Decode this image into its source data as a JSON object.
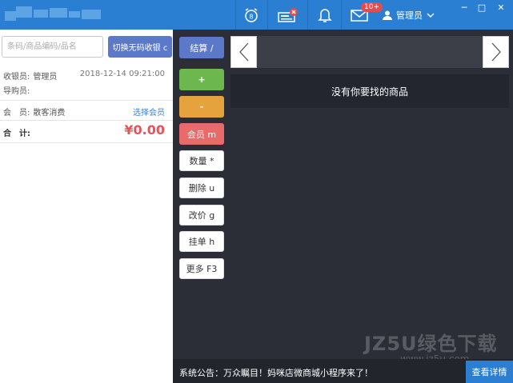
{
  "header": {
    "badge_count": "10+",
    "user_name": "管理员",
    "window_min": "─",
    "window_max": "□",
    "window_close": "✕",
    "icons": [
      "alarm-clock-icon",
      "card-reader-icon",
      "bell-icon",
      "mail-icon",
      "user-icon"
    ],
    "brand_color": "#2a7fd3"
  },
  "left": {
    "search_placeholder": "条码/商品编码/品名",
    "switch_button": "切换无码收银 c",
    "cashier_label": "收银员:",
    "cashier_name": "管理员",
    "datetime": "2018-12-14 09:21:00",
    "guide_label": "导购员:",
    "member_label": "会　员:",
    "member_value": "散客消费",
    "select_member": "选择会员",
    "total_label": "合　计:",
    "total_value": "¥0.00"
  },
  "middle": {
    "buttons": [
      {
        "label": "结算 /",
        "color": "#5b79c8"
      },
      {
        "label": "+",
        "color": "#6cb84f"
      },
      {
        "label": "-",
        "color": "#e6a23c"
      },
      {
        "label": "会员 m",
        "color": "#e86a6a"
      },
      {
        "label": "数量 *"
      },
      {
        "label": "删除 u"
      },
      {
        "label": "改价 g"
      },
      {
        "label": "挂单 h"
      },
      {
        "label": "更多 F3"
      }
    ]
  },
  "right": {
    "empty_text": "没有你要找的商品",
    "prev_arrow": "‹",
    "next_arrow": "›"
  },
  "notice": {
    "text": "系统公告：万众瞩目！妈咪店微商城小程序来了！",
    "button": "查看详情"
  },
  "watermark": {
    "line1": "JZ5U绿色下载",
    "line2": "www.jz5u.com"
  }
}
